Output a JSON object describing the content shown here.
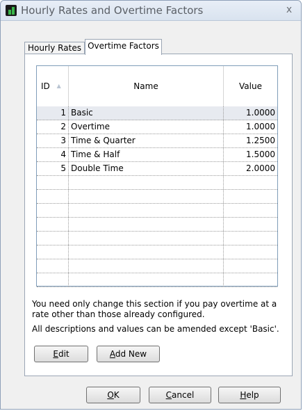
{
  "window": {
    "title": "Hourly Rates and Overtime Factors",
    "close_label": "x"
  },
  "tabs": [
    {
      "label": "Hourly Rates",
      "active": false
    },
    {
      "label": "Overtime Factors",
      "active": true
    }
  ],
  "grid": {
    "columns": {
      "id": "ID",
      "name": "Name",
      "value": "Value"
    },
    "sort_indicator": "▲",
    "rows": [
      {
        "id": "1",
        "name": "Basic",
        "value": "1.0000"
      },
      {
        "id": "2",
        "name": "Overtime",
        "value": "1.0000"
      },
      {
        "id": "3",
        "name": "Time & Quarter",
        "value": "1.2500"
      },
      {
        "id": "4",
        "name": "Time & Half",
        "value": "1.5000"
      },
      {
        "id": "5",
        "name": "Double Time",
        "value": "2.0000"
      }
    ],
    "selected_row": 0
  },
  "info": {
    "line1": "You need only change this section if you pay overtime at a rate other than those already configured.",
    "line2": "All descriptions and values can be amended except 'Basic'."
  },
  "buttons": {
    "edit": {
      "accel": "E",
      "rest": "dit"
    },
    "add_new": {
      "accel": "A",
      "rest": "dd New"
    },
    "ok": {
      "accel": "O",
      "rest": "K"
    },
    "cancel": {
      "accel": "C",
      "rest": "ancel"
    },
    "help": {
      "accel": "H",
      "rest": "elp"
    }
  },
  "colors": {
    "selected_row_bg": "#e7eaf0",
    "window_bg": "#f0f0f0",
    "icon_green": "#39b54a"
  }
}
